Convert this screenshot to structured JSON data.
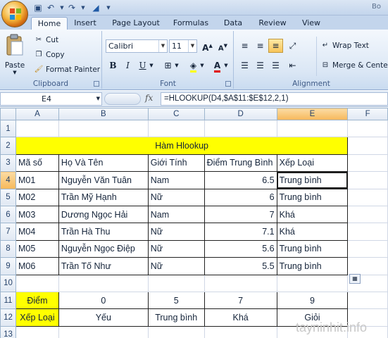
{
  "titlebar": {
    "title": "",
    "right_text": "Bo"
  },
  "tabs": [
    "Home",
    "Insert",
    "Page Layout",
    "Formulas",
    "Data",
    "Review",
    "View"
  ],
  "ribbon": {
    "clipboard": {
      "label": "Clipboard",
      "paste": "Paste",
      "cut": "Cut",
      "copy": "Copy",
      "format_painter": "Format Painter"
    },
    "font": {
      "label": "Font",
      "font_name": "Calibri",
      "font_size": "11",
      "bold": "B",
      "italic": "I",
      "underline": "U",
      "grow": "A",
      "shrink": "A",
      "font_color": "A"
    },
    "alignment": {
      "label": "Alignment",
      "wrap_text": "Wrap Text",
      "merge": "Merge & Center"
    }
  },
  "formula_bar": {
    "name_box": "E4",
    "fx": "fx",
    "formula": "=HLOOKUP(D4,$A$11:$E$12,2,1)"
  },
  "columns": [
    "A",
    "B",
    "C",
    "D",
    "E",
    "F"
  ],
  "rows": [
    "1",
    "2",
    "3",
    "4",
    "5",
    "6",
    "7",
    "8",
    "9",
    "10",
    "11",
    "12",
    "13"
  ],
  "sheet": {
    "title": "Hàm Hlookup",
    "headers": [
      "Mã số",
      "Họ Và Tên",
      "Giới Tính",
      "Điểm Trung Bình",
      "Xếp Loại"
    ],
    "records": [
      [
        "M01",
        "Nguyễn Văn Tuân",
        "Nam",
        "6.5",
        "Trung bình"
      ],
      [
        "M02",
        "Trần Mỹ Hạnh",
        "Nữ",
        "6",
        "Trung bình"
      ],
      [
        "M03",
        "Dương Ngọc Hải",
        "Nam",
        "7",
        "Khá"
      ],
      [
        "M04",
        "Trần Hà Thu",
        "Nữ",
        "7.1",
        "Khá"
      ],
      [
        "M05",
        "Nguyễn Ngọc Điệp",
        "Nữ",
        "5.6",
        "Trung bình"
      ],
      [
        "M06",
        "Trần Tố Như",
        "Nữ",
        "5.5",
        "Trung bình"
      ]
    ],
    "lookup_row1": [
      "Điểm",
      "0",
      "5",
      "7",
      "9"
    ],
    "lookup_row2": [
      "Xếp Loại",
      "Yếu",
      "Trung bình",
      "Khá",
      "Giỏi"
    ]
  },
  "watermark": "tayninhit.info",
  "colors": {
    "highlight": "#ffff00",
    "selected_header": "#f6b85a",
    "ribbon": "#dbe7f5"
  }
}
